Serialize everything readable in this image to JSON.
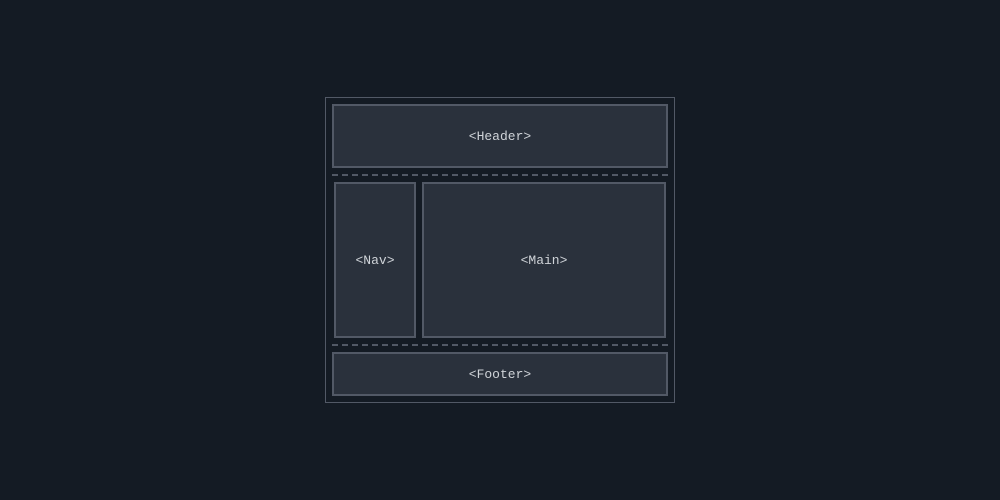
{
  "layout": {
    "header_label": "<Header>",
    "nav_label": "<Nav>",
    "main_label": "<Main>",
    "footer_label": "<Footer>"
  }
}
